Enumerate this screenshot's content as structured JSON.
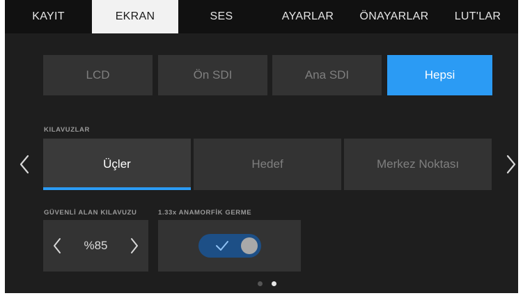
{
  "tabs": [
    {
      "label": "KAYIT"
    },
    {
      "label": "EKRAN"
    },
    {
      "label": "SES"
    },
    {
      "label": "AYARLAR"
    },
    {
      "label": "ÖNAYARLAR"
    },
    {
      "label": "LUT'LAR"
    }
  ],
  "active_tab": "EKRAN",
  "display_targets": [
    {
      "label": "LCD"
    },
    {
      "label": "Ön SDI"
    },
    {
      "label": "Ana SDI"
    },
    {
      "label": "Hepsi"
    }
  ],
  "active_display_target": "Hepsi",
  "guides": {
    "label": "KILAVUZLAR",
    "options": [
      {
        "label": "Üçler"
      },
      {
        "label": "Hedef"
      },
      {
        "label": "Merkez Noktası"
      }
    ],
    "selected": "Üçler"
  },
  "safe_area": {
    "label": "GÜVENLİ ALAN KILAVUZU",
    "value": "%85"
  },
  "anamorphic": {
    "label": "1.33x ANAMORFİK GERME",
    "enabled": true
  },
  "pagination": {
    "pages": 2,
    "current": 2
  },
  "colors": {
    "accent": "#2b9bf4",
    "background": "#1e1e1e",
    "tab_bar": "#111111",
    "button": "#333333",
    "toggle_on": "#1d4f86"
  },
  "icons": {
    "prev": "chevron-left-icon",
    "next": "chevron-right-icon",
    "check": "check-icon"
  }
}
